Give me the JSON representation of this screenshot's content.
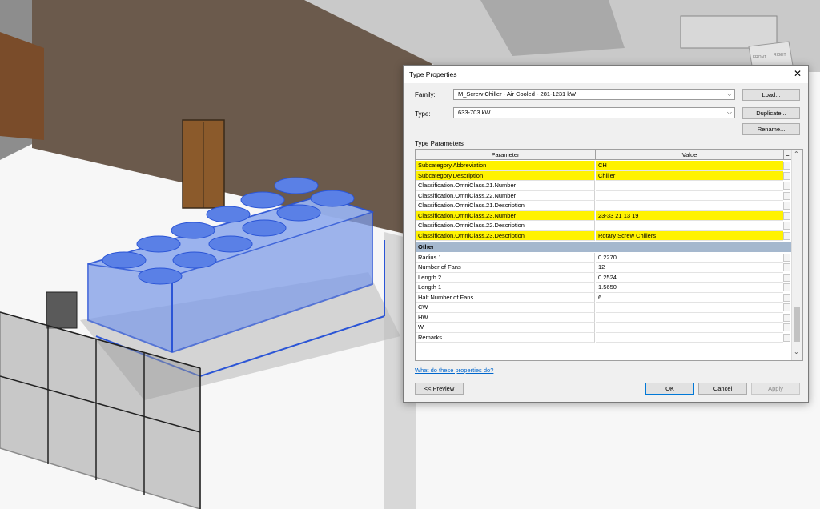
{
  "dialog": {
    "title": "Type Properties",
    "family_label": "Family:",
    "family_value": "M_Screw Chiller - Air Cooled - 281-1231 kW",
    "type_label": "Type:",
    "type_value": "633-703 kW",
    "load_button": "Load...",
    "duplicate_button": "Duplicate...",
    "rename_button": "Rename...",
    "type_parameters_label": "Type Parameters",
    "help_link": "What do these properties do?",
    "preview_button": "<< Preview",
    "ok_button": "OK",
    "cancel_button": "Cancel",
    "apply_button": "Apply"
  },
  "table": {
    "col_parameter": "Parameter",
    "col_value": "Value",
    "col_equals": "=",
    "rows_top": [
      {
        "param": "Subcategory.Abbreviation",
        "value": "CH",
        "highlight": true
      },
      {
        "param": "Subcategory.Description",
        "value": "Chiller",
        "highlight": true
      },
      {
        "param": "Classification.OmniClass.21.Number",
        "value": "",
        "highlight": false
      },
      {
        "param": "Classification.OmniClass.22.Number",
        "value": "",
        "highlight": false
      },
      {
        "param": "Classification.OmniClass.21.Description",
        "value": "",
        "highlight": false
      },
      {
        "param": "Classification.OmniClass.23.Number",
        "value": "23-33 21 13 19",
        "highlight": true
      },
      {
        "param": "Classification.OmniClass.22.Description",
        "value": "",
        "highlight": false
      },
      {
        "param": "Classification.OmniClass.23.Description",
        "value": "Rotary Screw Chillers",
        "highlight": true
      }
    ],
    "group_other": "Other",
    "rows_other": [
      {
        "param": "Radius 1",
        "value": "0.2270"
      },
      {
        "param": "Number of Fans",
        "value": "12"
      },
      {
        "param": "Length 2",
        "value": "0.2524"
      },
      {
        "param": "Length 1",
        "value": "1.5650"
      },
      {
        "param": "Half Number of Fans",
        "value": "6"
      },
      {
        "param": "CW",
        "value": ""
      },
      {
        "param": "HW",
        "value": ""
      },
      {
        "param": "W",
        "value": ""
      },
      {
        "param": "Remarks",
        "value": ""
      }
    ]
  },
  "viewcube": {
    "front": "FRONT",
    "right": "RIGHT"
  }
}
